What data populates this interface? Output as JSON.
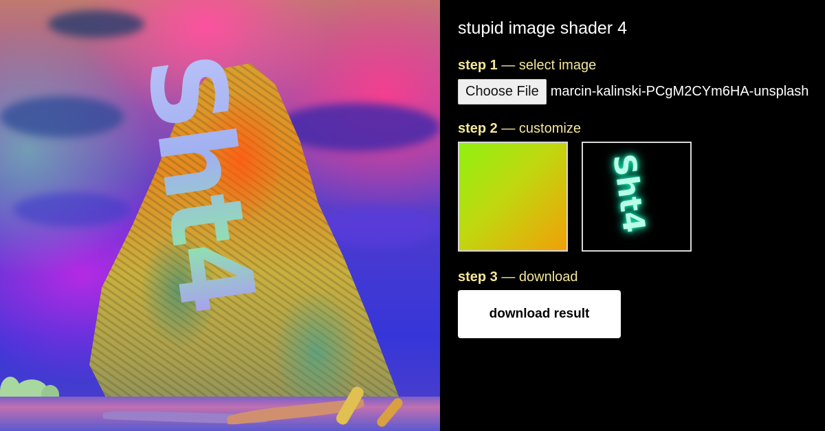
{
  "app": {
    "title": "stupid image shader 4"
  },
  "canvas": {
    "overlay_text": "Sht4"
  },
  "step1": {
    "number": "step 1",
    "label": " — select image",
    "choose_file_label": "Choose File",
    "file_name": "marcin-kalinski-PCgM2CYm6HA-unsplash"
  },
  "step2": {
    "number": "step 2",
    "label": " — customize",
    "gradient_colors": [
      "#90f010",
      "#c0d810",
      "#f0a008"
    ],
    "preview_text": "Sht4",
    "preview_glow_color": "#20e8b0"
  },
  "step3": {
    "number": "step 3",
    "label": " — download",
    "download_label": "download result"
  },
  "colors": {
    "step_label": "#f5e79a",
    "panel_background": "#000000",
    "title": "#ffffff"
  }
}
